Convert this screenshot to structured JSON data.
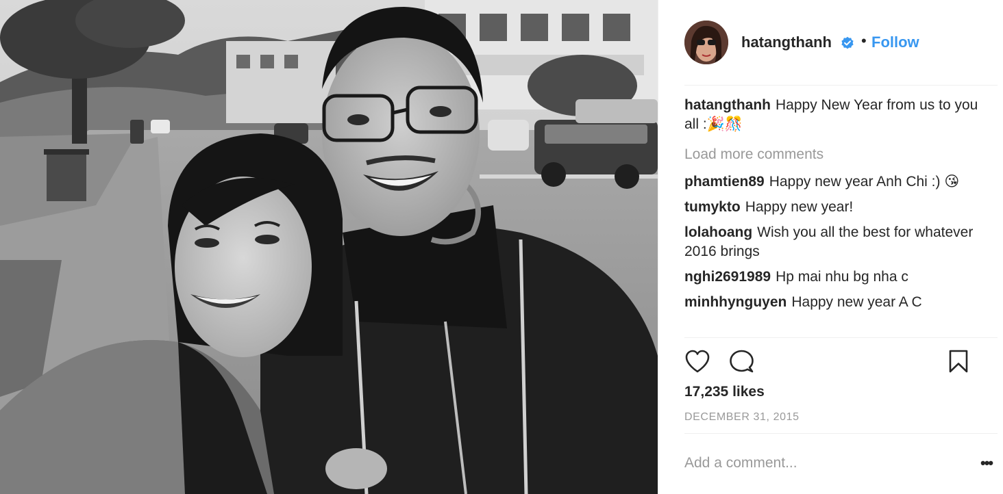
{
  "post": {
    "username": "hatangthanh",
    "follow_label": "Follow",
    "separator": "•",
    "caption_user": "hatangthanh",
    "caption_text": "Happy New Year from us to you all :🎉🎊",
    "load_more": "Load more comments",
    "comments": [
      {
        "user": "phamtien89",
        "text": "Happy new year Anh Chi :) 😘"
      },
      {
        "user": "tumykto",
        "text": "Happy new year!"
      },
      {
        "user": "lolahoang",
        "text": "Wish you all the best for whatever 2016 brings"
      },
      {
        "user": "nghi2691989",
        "text": "Hp mai nhu bg nha c"
      },
      {
        "user": "minhhynguyen",
        "text": "Happy new year A C"
      }
    ],
    "likes": "17,235 likes",
    "date": "DECEMBER 31, 2015",
    "add_comment_placeholder": "Add a comment...",
    "more_options": "•••"
  },
  "icons": {
    "like": "heart-icon",
    "comment": "comment-bubble-icon",
    "save": "bookmark-icon",
    "verified": "verified-badge-icon",
    "more": "more-options-icon"
  },
  "colors": {
    "link_blue": "#3897f0",
    "verified_blue": "#3897f0",
    "text": "#262626",
    "muted": "#999999",
    "divider": "#efefef"
  }
}
